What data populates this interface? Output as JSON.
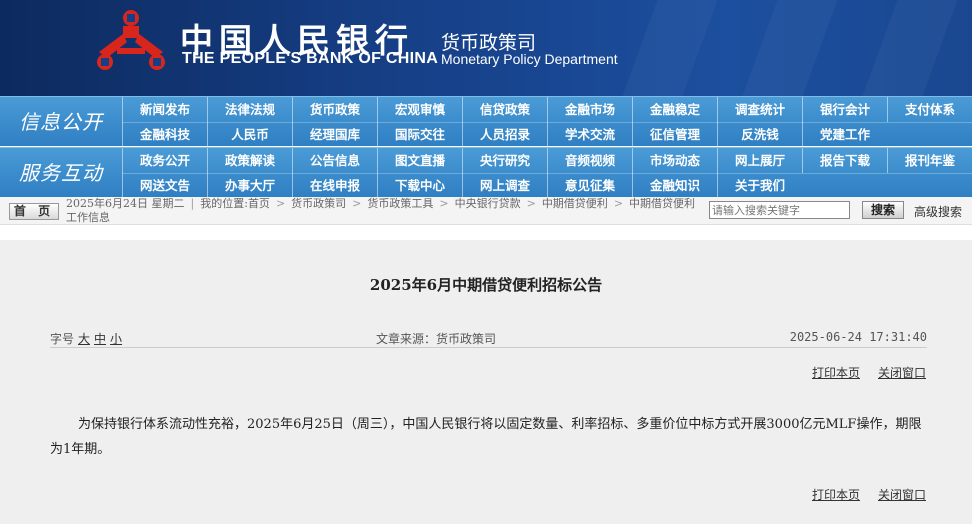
{
  "header": {
    "cn_name": "中国人民银行",
    "en_name": "THE PEOPLE'S BANK OF CHINA",
    "dept_cn": "货币政策司",
    "dept_en": "Monetary Policy Department",
    "logo_icon": "pboc-logo-icon",
    "colors": {
      "header_bg": "#163f86",
      "logo_red": "#d8261c",
      "nav_bg": "#3a8ccc"
    }
  },
  "nav": {
    "section1_title": "信息公开",
    "section1_items": [
      "新闻发布",
      "法律法规",
      "货币政策",
      "宏观审慎",
      "信贷政策",
      "金融市场",
      "金融稳定",
      "调查统计",
      "银行会计",
      "支付体系",
      "金融科技",
      "人民币",
      "经理国库",
      "国际交往",
      "人员招录",
      "学术交流",
      "征信管理",
      "反洗钱",
      "党建工作"
    ],
    "section2_title": "服务互动",
    "section2_items": [
      "政务公开",
      "政策解读",
      "公告信息",
      "图文直播",
      "央行研究",
      "音频视频",
      "市场动态",
      "网上展厅",
      "报告下载",
      "报刊年鉴",
      "网送文告",
      "办事大厅",
      "在线申报",
      "下载中心",
      "网上调查",
      "意见征集",
      "金融知识",
      "关于我们"
    ]
  },
  "breadcrumb": {
    "home_label": "首 页",
    "date": "2025年6月24日 星期二",
    "location_label": "我的位置:",
    "items": [
      "首页",
      "货币政策司",
      "货币政策工具",
      "中央银行贷款",
      "中期借贷便利",
      "中期借贷便利工作信息"
    ],
    "search_placeholder": "请输入搜索关键字",
    "search_button": "搜索",
    "advanced_search": "高级搜索"
  },
  "article": {
    "title": "2025年6月中期借贷便利招标公告",
    "font_size_label": "字号",
    "font_sizes": [
      "大",
      "中",
      "小"
    ],
    "source": "文章来源：货币政策司",
    "time": "2025-06-24 17:31:40",
    "print": "打印本页",
    "close": "关闭窗口",
    "body": "为保持银行体系流动性充裕，2025年6月25日（周三），中国人民银行将以固定数量、利率招标、多重价位中标方式开展3000亿元MLF操作，期限为1年期。"
  }
}
